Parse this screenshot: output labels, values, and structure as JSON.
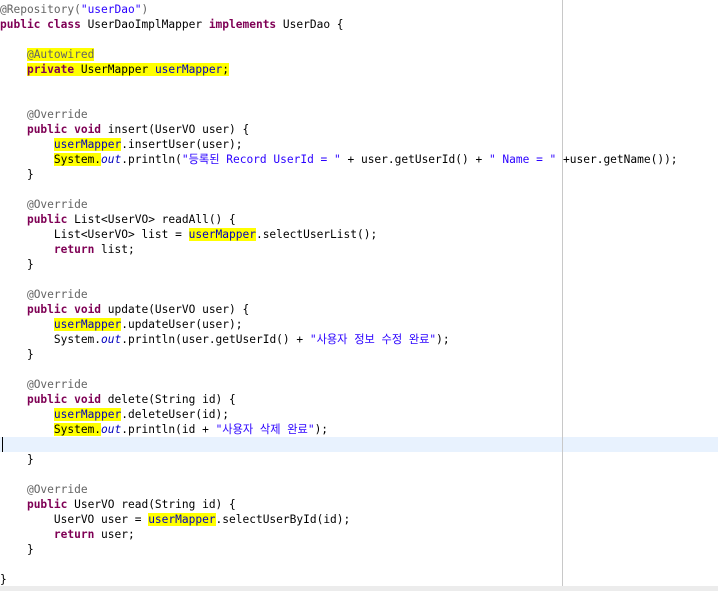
{
  "lines": [
    [
      {
        "t": "@Repository(",
        "c": "ann"
      },
      {
        "t": "\"userDao\"",
        "c": "str"
      },
      {
        "t": ")",
        "c": "ann"
      }
    ],
    [
      {
        "t": "public class ",
        "c": "kw"
      },
      {
        "t": "UserDaoImplMapper "
      },
      {
        "t": "implements ",
        "c": "kw"
      },
      {
        "t": "UserDao {"
      }
    ],
    [],
    [
      {
        "t": "    "
      },
      {
        "t": "@Autowired",
        "c": "ann hl"
      }
    ],
    [
      {
        "t": "    "
      },
      {
        "t": "private ",
        "c": "kw hl"
      },
      {
        "t": "UserMapper ",
        "c": "hl"
      },
      {
        "t": "userMapper",
        "c": "fld hl"
      },
      {
        "t": ";",
        "c": "hl"
      }
    ],
    [],
    [],
    [
      {
        "t": "    "
      },
      {
        "t": "@Override",
        "c": "ann"
      }
    ],
    [
      {
        "t": "    "
      },
      {
        "t": "public void ",
        "c": "kw"
      },
      {
        "t": "insert(UserVO user) {"
      }
    ],
    [
      {
        "t": "        "
      },
      {
        "t": "userMapper",
        "c": "fld hl"
      },
      {
        "t": ".insertUser(user);"
      }
    ],
    [
      {
        "t": "        "
      },
      {
        "t": "System.",
        "c": "hl"
      },
      {
        "t": "out",
        "c": "sfld"
      },
      {
        "t": ".println("
      },
      {
        "t": "\"등록된 Record UserId = \"",
        "c": "str"
      },
      {
        "t": " + user.getUserId() + "
      },
      {
        "t": "\" Name = \"",
        "c": "str"
      },
      {
        "t": " +user.getName());"
      }
    ],
    [
      {
        "t": "    }"
      }
    ],
    [],
    [
      {
        "t": "    "
      },
      {
        "t": "@Override",
        "c": "ann"
      }
    ],
    [
      {
        "t": "    "
      },
      {
        "t": "public ",
        "c": "kw"
      },
      {
        "t": "List<UserVO> readAll() {"
      }
    ],
    [
      {
        "t": "        List<UserVO> list = "
      },
      {
        "t": "userMapper",
        "c": "fld hl"
      },
      {
        "t": ".selectUserList();"
      }
    ],
    [
      {
        "t": "        "
      },
      {
        "t": "return ",
        "c": "kw"
      },
      {
        "t": "list;"
      }
    ],
    [
      {
        "t": "    }"
      }
    ],
    [],
    [
      {
        "t": "    "
      },
      {
        "t": "@Override",
        "c": "ann"
      }
    ],
    [
      {
        "t": "    "
      },
      {
        "t": "public void ",
        "c": "kw"
      },
      {
        "t": "update(UserVO user) {"
      }
    ],
    [
      {
        "t": "        "
      },
      {
        "t": "userMapper",
        "c": "fld hl"
      },
      {
        "t": ".updateUser(user);"
      }
    ],
    [
      {
        "t": "        System."
      },
      {
        "t": "out",
        "c": "sfld"
      },
      {
        "t": ".println(user.getUserId() + "
      },
      {
        "t": "\"사용자 정보 수정 완료\"",
        "c": "str"
      },
      {
        "t": ");"
      }
    ],
    [
      {
        "t": "    }"
      }
    ],
    [],
    [
      {
        "t": "    "
      },
      {
        "t": "@Override",
        "c": "ann"
      }
    ],
    [
      {
        "t": "    "
      },
      {
        "t": "public void ",
        "c": "kw"
      },
      {
        "t": "delete(String id) {"
      }
    ],
    [
      {
        "t": "        "
      },
      {
        "t": "userMapper",
        "c": "fld hl"
      },
      {
        "t": ".deleteUser(id);"
      }
    ],
    [
      {
        "t": "        "
      },
      {
        "t": "System.",
        "c": "hl"
      },
      {
        "t": "out",
        "c": "sfld"
      },
      {
        "t": ".println(id + "
      },
      {
        "t": "\"사용자 삭제 완료\"",
        "c": "str"
      },
      {
        "t": ");"
      }
    ],
    [],
    [
      {
        "t": "    }"
      }
    ],
    [],
    [
      {
        "t": "    "
      },
      {
        "t": "@Override",
        "c": "ann"
      }
    ],
    [
      {
        "t": "    "
      },
      {
        "t": "public ",
        "c": "kw"
      },
      {
        "t": "UserVO read(String id) {"
      }
    ],
    [
      {
        "t": "        UserVO user = "
      },
      {
        "t": "userMapper",
        "c": "fld hl"
      },
      {
        "t": ".selectUserById(id);"
      }
    ],
    [
      {
        "t": "        "
      },
      {
        "t": "return ",
        "c": "kw"
      },
      {
        "t": "user;"
      }
    ],
    [
      {
        "t": "    }"
      }
    ],
    [],
    [
      {
        "t": "}"
      }
    ]
  ]
}
